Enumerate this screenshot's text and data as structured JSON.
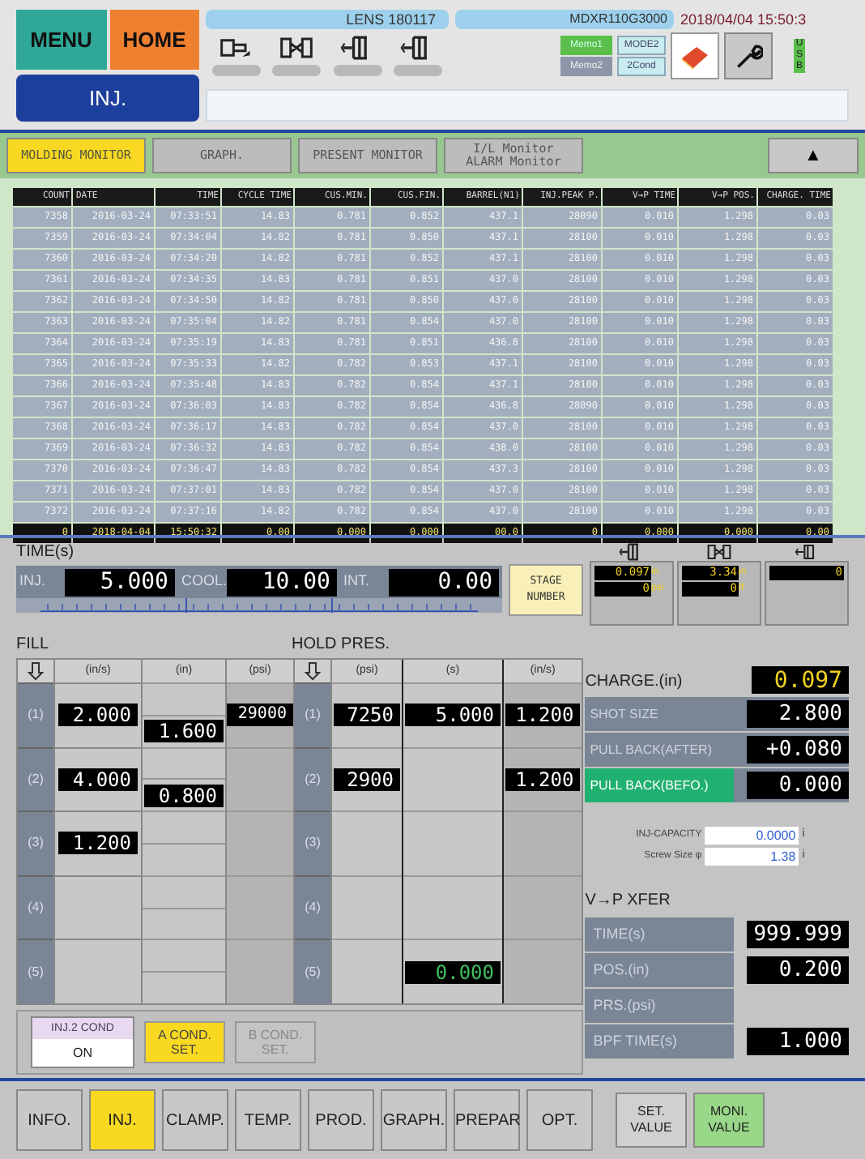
{
  "header": {
    "menu": "MENU",
    "home": "HOME",
    "screen": "INJ.",
    "mold_name": "LENS 180117",
    "machine": "MDXR110G3000",
    "datetime": "2018/04/04 15:50:3",
    "memos": [
      {
        "label": "Memo1",
        "selected": true
      },
      {
        "label": "Memo2",
        "selected": false
      }
    ],
    "mode": "MODE2",
    "cond": "2Cond",
    "usb": "USB"
  },
  "tabs": [
    {
      "label": "MOLDING MONITOR",
      "selected": true
    },
    {
      "label": "GRAPH.",
      "selected": false
    },
    {
      "label": "PRESENT MONITOR",
      "selected": false
    },
    {
      "label": "I/L Monitor ALARM Monitor",
      "selected": false
    }
  ],
  "scroll_up": "▲",
  "table": {
    "columns": [
      "COUNT",
      "DATE",
      "TIME",
      "CYCLE TIME",
      "CUS.MIN.",
      "CUS.FIN.",
      "BARREL(N1)",
      "INJ.PEAK P.",
      "V→P TIME",
      "V→P POS.",
      "CHARGE. TIME"
    ],
    "rows": [
      [
        "7358",
        "2016-03-24",
        "07:33:51",
        "14.83",
        "0.781",
        "0.852",
        "437.1",
        "28090",
        "0.010",
        "1.298",
        "0.03"
      ],
      [
        "7359",
        "2016-03-24",
        "07:34:04",
        "14.82",
        "0.781",
        "0.850",
        "437.1",
        "28100",
        "0.010",
        "1.298",
        "0.03"
      ],
      [
        "7360",
        "2016-03-24",
        "07:34:20",
        "14.82",
        "0.781",
        "0.852",
        "437.1",
        "28100",
        "0.010",
        "1.298",
        "0.03"
      ],
      [
        "7361",
        "2016-03-24",
        "07:34:35",
        "14.83",
        "0.781",
        "0.851",
        "437.0",
        "28100",
        "0.010",
        "1.298",
        "0.03"
      ],
      [
        "7362",
        "2016-03-24",
        "07:34:50",
        "14.82",
        "0.781",
        "0.850",
        "437.0",
        "28100",
        "0.010",
        "1.298",
        "0.03"
      ],
      [
        "7363",
        "2016-03-24",
        "07:35:04",
        "14.82",
        "0.781",
        "0.854",
        "437.0",
        "28100",
        "0.010",
        "1.298",
        "0.03"
      ],
      [
        "7364",
        "2016-03-24",
        "07:35:19",
        "14.83",
        "0.781",
        "0.851",
        "436.8",
        "28100",
        "0.010",
        "1.298",
        "0.03"
      ],
      [
        "7365",
        "2016-03-24",
        "07:35:33",
        "14.82",
        "0.782",
        "0.853",
        "437.1",
        "28100",
        "0.010",
        "1.298",
        "0.03"
      ],
      [
        "7366",
        "2016-03-24",
        "07:35:48",
        "14.83",
        "0.782",
        "0.854",
        "437.1",
        "28100",
        "0.010",
        "1.298",
        "0.03"
      ],
      [
        "7367",
        "2016-03-24",
        "07:36:03",
        "14.83",
        "0.782",
        "0.854",
        "436.8",
        "28090",
        "0.010",
        "1.298",
        "0.03"
      ],
      [
        "7368",
        "2016-03-24",
        "07:36:17",
        "14.83",
        "0.782",
        "0.854",
        "437.0",
        "28100",
        "0.010",
        "1.298",
        "0.03"
      ],
      [
        "7369",
        "2016-03-24",
        "07:36:32",
        "14.83",
        "0.782",
        "0.854",
        "438.0",
        "28100",
        "0.010",
        "1.298",
        "0.03"
      ],
      [
        "7370",
        "2016-03-24",
        "07:36:47",
        "14.83",
        "0.782",
        "0.854",
        "437.3",
        "28100",
        "0.010",
        "1.298",
        "0.03"
      ],
      [
        "7371",
        "2016-03-24",
        "07:37:01",
        "14.83",
        "0.782",
        "0.854",
        "437.0",
        "28100",
        "0.010",
        "1.298",
        "0.03"
      ],
      [
        "7372",
        "2016-03-24",
        "07:37:16",
        "14.82",
        "0.782",
        "0.854",
        "437.0",
        "28100",
        "0.010",
        "1.298",
        "0.03"
      ]
    ],
    "summary": [
      "0",
      "2018-04-04",
      "15:50:32",
      "0.00",
      "0.000",
      "0.000",
      "00.0",
      "0",
      "0.000",
      "0.000",
      "0.00"
    ]
  },
  "time": {
    "title": "TIME(s)",
    "fields": [
      {
        "label": "INJ.",
        "value": "5.000"
      },
      {
        "label": "COOL.",
        "value": "10.00"
      },
      {
        "label": "INT.",
        "value": "0.00"
      }
    ],
    "stage_button": "STAGE NUMBER",
    "monitors": [
      {
        "kind": "clamp",
        "readings": [
          {
            "value": "0.097",
            "unit": "in"
          },
          {
            "value": "0",
            "unit": "psi"
          }
        ]
      },
      {
        "kind": "mold",
        "readings": [
          {
            "value": "3.34",
            "unit": "in"
          },
          {
            "value": "0",
            "unit": "tf"
          }
        ]
      },
      {
        "kind": "ejector",
        "readings": [
          {
            "value": "0"
          }
        ]
      }
    ]
  },
  "fill": {
    "title": "FILL",
    "columns": [
      "(in/s)",
      "(in)",
      "(psi)"
    ],
    "rows": [
      {
        "label": "(1)",
        "speed": "2.000",
        "pressure": "29000"
      },
      {
        "label": "(2)",
        "speed": "4.000"
      },
      {
        "label": "(3)",
        "speed": "1.200"
      },
      {
        "label": "(4)"
      },
      {
        "label": "(5)"
      }
    ],
    "positions": [
      "1.600",
      "0.800"
    ]
  },
  "hold": {
    "title": "HOLD PRES.",
    "columns": [
      "(psi)",
      "(s)",
      "(in/s)"
    ],
    "rows": [
      {
        "label": "(1)",
        "pressure": "7250",
        "time": "5.000",
        "speed": "1.200"
      },
      {
        "label": "(2)",
        "pressure": "2900",
        "speed": "1.200"
      },
      {
        "label": "(3)"
      },
      {
        "label": "(4)"
      },
      {
        "label": "(5)",
        "time": "0.000"
      }
    ]
  },
  "charge": {
    "label": "CHARGE.(in)",
    "value": "0.097",
    "settings": [
      {
        "label": "SHOT SIZE",
        "value": "2.800",
        "selected": false
      },
      {
        "label": "PULL BACK(AFTER)",
        "value": "+0.080",
        "selected": false
      },
      {
        "label": "PULL BACK(BEFO.)",
        "value": "0.000",
        "selected": true
      }
    ],
    "capacity": [
      {
        "label": "INJ-CAPACITY",
        "value": "0.0000",
        "unit": "i"
      },
      {
        "label": "Screw Size φ",
        "value": "1.38",
        "unit": "i"
      }
    ]
  },
  "xfer": {
    "title": "V→P XFER",
    "rows": [
      {
        "label": "TIME(s)",
        "value": "999.999"
      },
      {
        "label": "POS.(in)",
        "value": "0.200"
      },
      {
        "label": "PRS.(psi)"
      },
      {
        "label": "BPF TIME(s)",
        "value": "1.000"
      }
    ]
  },
  "inj2": {
    "label": "INJ.2 COND",
    "value": "ON"
  },
  "cond_buttons": [
    {
      "label": "A COND. SET.",
      "selected": true
    },
    {
      "label": "B COND. SET.",
      "selected": false
    }
  ],
  "nav": [
    {
      "label": "INFO.",
      "selected": false
    },
    {
      "label": "INJ.",
      "selected": true
    },
    {
      "label": "CLAMP.",
      "selected": false
    },
    {
      "label": "TEMP.",
      "selected": false
    },
    {
      "label": "PROD.",
      "selected": false
    },
    {
      "label": "GRAPH.",
      "selected": false
    },
    {
      "label": "PREPAR",
      "selected": false
    },
    {
      "label": "OPT.",
      "selected": false
    }
  ],
  "value_modes": [
    {
      "label": "SET. VALUE",
      "selected": false
    },
    {
      "label": "MONI. VALUE",
      "selected": true
    }
  ]
}
